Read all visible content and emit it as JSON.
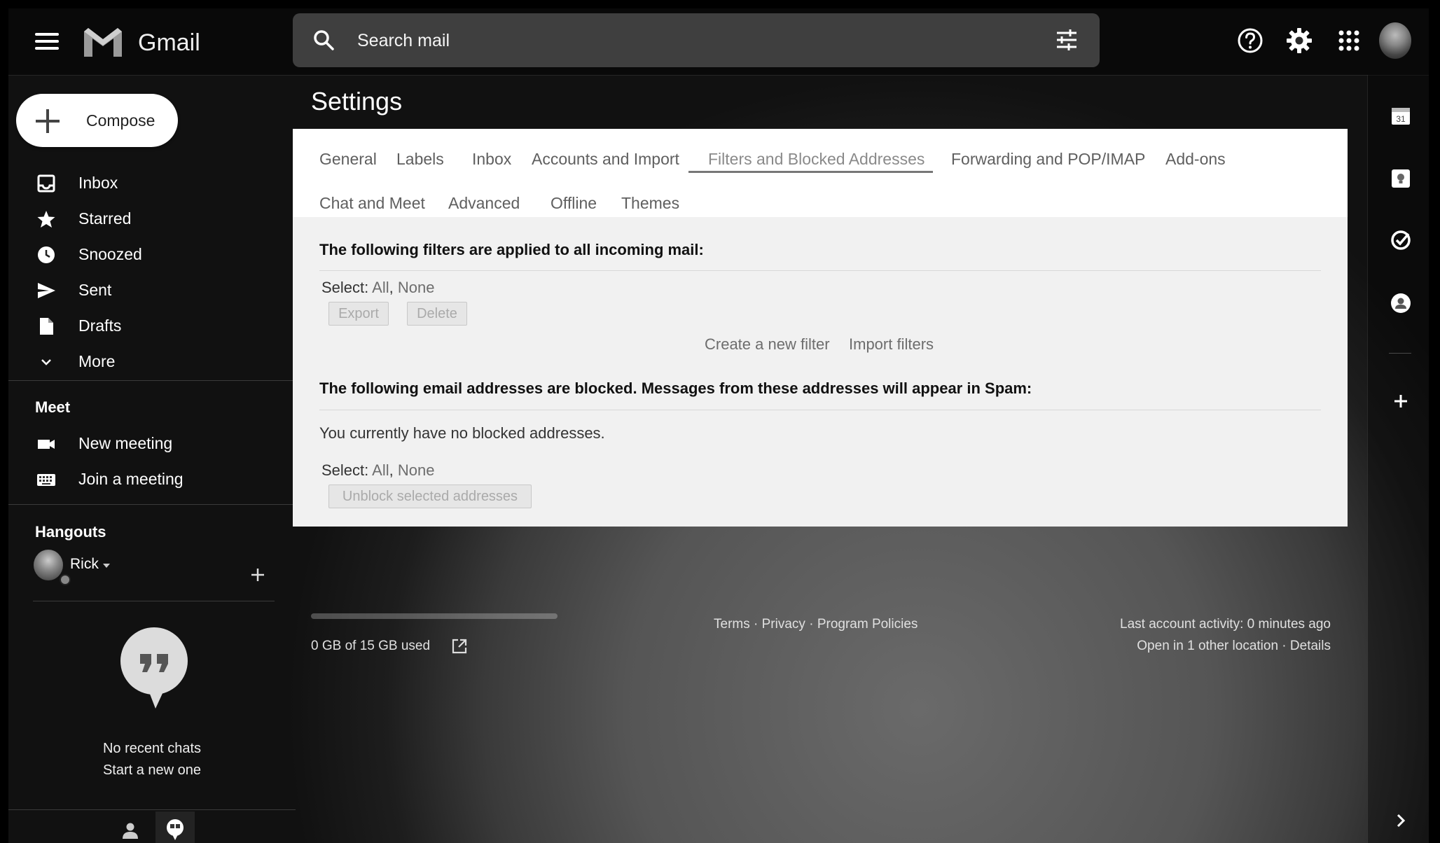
{
  "app": {
    "name": "Gmail"
  },
  "search": {
    "placeholder": "Search mail"
  },
  "compose": {
    "label": "Compose"
  },
  "nav": [
    {
      "label": "Inbox",
      "icon": "inbox-icon"
    },
    {
      "label": "Starred",
      "icon": "star-icon"
    },
    {
      "label": "Snoozed",
      "icon": "clock-icon"
    },
    {
      "label": "Sent",
      "icon": "send-icon"
    },
    {
      "label": "Drafts",
      "icon": "draft-icon"
    },
    {
      "label": "More",
      "icon": "chevron-down-icon"
    }
  ],
  "meet": {
    "title": "Meet",
    "items": [
      {
        "label": "New meeting",
        "icon": "video-icon"
      },
      {
        "label": "Join a meeting",
        "icon": "keyboard-icon"
      }
    ]
  },
  "hangouts": {
    "title": "Hangouts",
    "user": "Rick",
    "empty_line1": "No recent chats",
    "empty_line2": "Start a new one"
  },
  "settings": {
    "title": "Settings",
    "tabs_row1": [
      "General",
      "Labels",
      "Inbox",
      "Accounts and Import",
      "Filters and Blocked Addresses",
      "Forwarding and POP/IMAP",
      "Add-ons"
    ],
    "tabs_row2": [
      "Chat and Meet",
      "Advanced",
      "Offline",
      "Themes"
    ],
    "active_tab": "Filters and Blocked Addresses",
    "filters_heading": "The following filters are applied to all incoming mail:",
    "select_label": "Select:",
    "select_all": "All",
    "select_none": "None",
    "export_label": "Export",
    "delete_label": "Delete",
    "create_filter": "Create a new filter",
    "import_filters": "Import filters",
    "blocked_heading": "The following email addresses are blocked. Messages from these addresses will appear in Spam:",
    "no_blocked": "You currently have no blocked addresses.",
    "unblock_label": "Unblock selected addresses"
  },
  "footer": {
    "storage": "0 GB of 15 GB used",
    "storage_fraction": 0.0,
    "terms": "Terms",
    "privacy": "Privacy",
    "program_policies": "Program Policies",
    "separator": " · ",
    "last_activity": "Last account activity: 0 minutes ago",
    "other_location": "Open in 1 other location",
    "details": "Details"
  },
  "rail": {
    "calendar_day": "31",
    "icons": [
      "calendar-icon",
      "keep-icon",
      "tasks-icon",
      "contacts-icon",
      "add-icon"
    ]
  },
  "colors": {
    "accent": "#ffffff",
    "panel_bg": "#f1f1f1",
    "tab_active": "#8a8a8a"
  }
}
